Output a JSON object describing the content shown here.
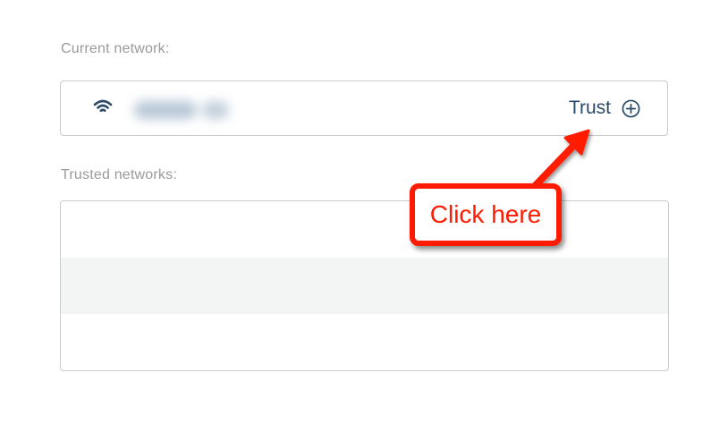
{
  "current_network": {
    "label": "Current network:",
    "icon": "wifi-icon",
    "trust_label": "Trust",
    "trust_icon": "plus-circle-icon"
  },
  "trusted_networks": {
    "label": "Trusted networks:",
    "rows": [
      "",
      "",
      ""
    ]
  },
  "annotation": {
    "text": "Click here",
    "color": "#ff1a00"
  },
  "colors": {
    "accent": "#2a4a68",
    "label": "#9a9a9a",
    "border": "#c9cccf",
    "alt_row": "#f3f4f4"
  }
}
